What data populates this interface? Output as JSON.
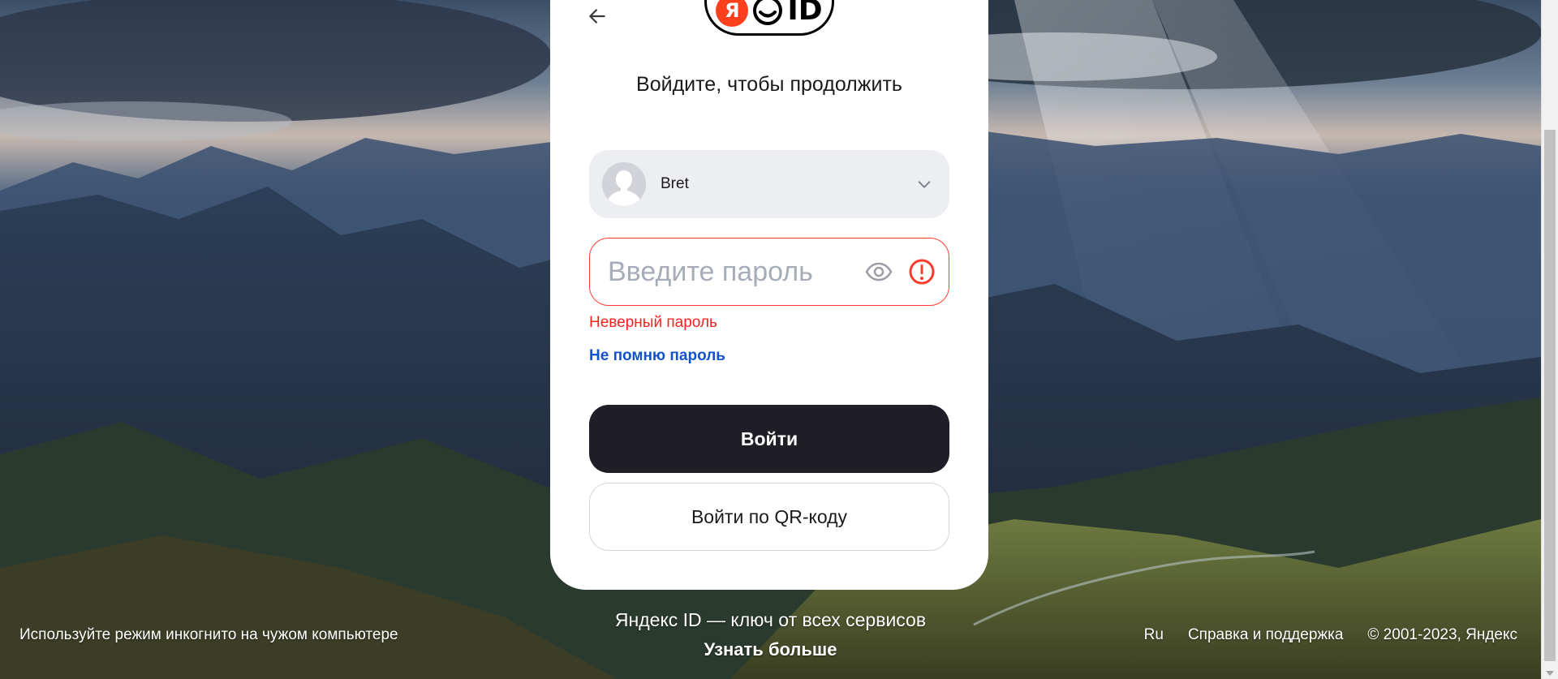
{
  "background": {
    "sky_color": "#3c5570",
    "mountain_color": "#2a3d57",
    "valley_color": "#8a8c3a"
  },
  "card": {
    "back_icon": "arrow-left-icon",
    "logo": {
      "ya": "Я",
      "id": "ID"
    },
    "title": "Войдите, чтобы продолжить",
    "account": {
      "name": "Bret",
      "avatar_icon": "user-silhouette-icon",
      "chevron_icon": "chevron-down-icon"
    },
    "password": {
      "placeholder": "Введите пароль",
      "value": "",
      "eye_icon": "eye-icon",
      "warning_icon": "exclamation-circle-icon",
      "error": "Неверный пароль"
    },
    "forgot_link": "Не помню пароль",
    "login_button": "Войти",
    "qr_button": "Войти по QR-коду"
  },
  "footer": {
    "incognito": "Используйте режим инкогнито на чужом компьютере",
    "tagline": "Яндекс ID — ключ от всех сервисов",
    "learn_more": "Узнать больше",
    "lang": "Ru",
    "help": "Справка и поддержка",
    "copyright": "© 2001-2023, Яндекс"
  },
  "colors": {
    "accent_dark": "#1f1e26",
    "error_red": "#ff1f1f",
    "link_blue": "#1352c9",
    "logo_red": "#fc3f1d"
  }
}
